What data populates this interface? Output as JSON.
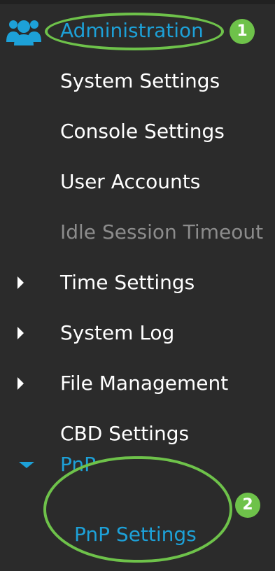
{
  "nav": {
    "section": {
      "icon": "users-icon",
      "label": "Administration"
    },
    "items": [
      {
        "label": "System Settings",
        "state": "default"
      },
      {
        "label": "Console Settings",
        "state": "default"
      },
      {
        "label": "User Accounts",
        "state": "default"
      },
      {
        "label": "Idle Session Timeout",
        "state": "disabled"
      },
      {
        "label": "Time Settings",
        "state": "collapsed"
      },
      {
        "label": "System Log",
        "state": "collapsed"
      },
      {
        "label": "File Management",
        "state": "collapsed"
      },
      {
        "label": "CBD Settings",
        "state": "default"
      },
      {
        "label": "PnP",
        "state": "expanded"
      },
      {
        "label": "PnP Settings",
        "state": "selected"
      }
    ]
  },
  "callouts": {
    "badge1": "1",
    "badge2": "2"
  },
  "colors": {
    "background": "#2b2b2b",
    "text": "#ffffff",
    "disabled_text": "#8c8c8c",
    "accent": "#1da1d8",
    "highlight": "#6ec24a"
  }
}
